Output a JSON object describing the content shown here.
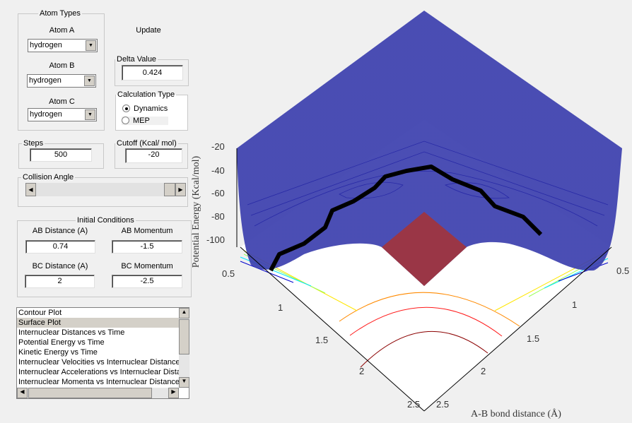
{
  "atom_types": {
    "title": "Atom Types",
    "atom_a_label": "Atom A",
    "atom_a_value": "hydrogen",
    "atom_b_label": "Atom B",
    "atom_b_value": "hydrogen",
    "atom_c_label": "Atom C",
    "atom_c_value": "hydrogen"
  },
  "update_label": "Update",
  "delta": {
    "title": "Delta Value",
    "value": "0.424"
  },
  "calculation_type": {
    "title": "Calculation Type",
    "options": [
      "Dynamics",
      "MEP"
    ],
    "selected": "Dynamics"
  },
  "steps": {
    "title": "Steps",
    "value": "500"
  },
  "cutoff": {
    "title": "Cutoff (Kcal/ mol)",
    "value": "-20"
  },
  "collision_angle": {
    "title": "Collision Angle",
    "slider_fraction": 0.95
  },
  "initial_conditions": {
    "title": "Initial Conditions",
    "ab_distance_label": "AB Distance (A)",
    "ab_distance": "0.74",
    "ab_momentum_label": "AB Momentum",
    "ab_momentum": "-1.5",
    "bc_distance_label": "BC Distance (A)",
    "bc_distance": "2",
    "bc_momentum_label": "BC Momentum",
    "bc_momentum": "-2.5"
  },
  "plot_list": {
    "items": [
      "Contour Plot",
      "Surface Plot",
      "Internuclear Distances vs Time",
      "Potential Energy vs Time",
      "Kinetic Energy vs Time",
      "Internuclear Velocities vs Internuclear Distance",
      "Internuclear Accelerations vs Internuclear Distance",
      "Internuclear Momenta vs Internuclear Distance"
    ],
    "selected": "Surface Plot"
  },
  "plot": {
    "type": "surface",
    "zlabel": "Potential Energy (Kcal/mol)",
    "xlabel": "A-B bond distance (Å)",
    "z_ticks": [
      "-20",
      "-40",
      "-60",
      "-80",
      "-100"
    ],
    "left_ticks": [
      "0.5",
      "1",
      "1.5",
      "2",
      "2.5"
    ],
    "right_ticks": [
      "0.5",
      "1",
      "1.5",
      "2",
      "2.5"
    ],
    "colormap": "jet",
    "trajectory_color": "#000000"
  }
}
